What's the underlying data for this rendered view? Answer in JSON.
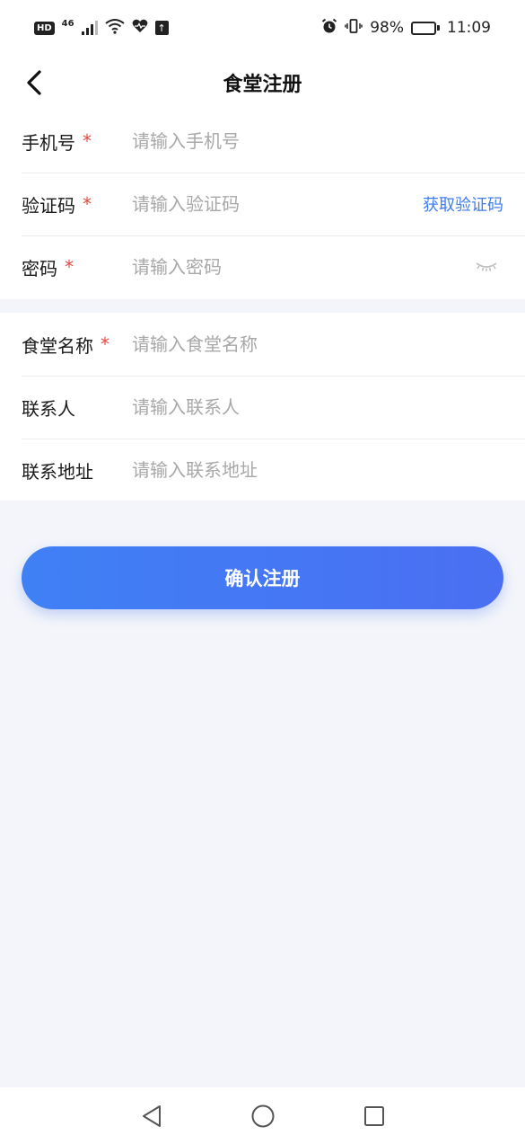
{
  "status_bar": {
    "hd_badge": "HD",
    "network": "46",
    "battery_percent": "98%",
    "battery_level": 0.98,
    "time": "11:09",
    "icons": [
      "hd-icon",
      "signal-icon",
      "wifi-icon",
      "heart-icon",
      "upload-icon",
      "alarm-icon",
      "vibrate-icon",
      "battery-icon"
    ]
  },
  "header": {
    "title": "食堂注册",
    "back_icon": "chevron-left-icon"
  },
  "form": {
    "phone": {
      "label": "手机号",
      "required_mark": "*",
      "placeholder": "请输入手机号",
      "value": ""
    },
    "code": {
      "label": "验证码",
      "required_mark": "*",
      "placeholder": "请输入验证码",
      "value": "",
      "action": "获取验证码"
    },
    "password": {
      "label": "密码",
      "required_mark": "*",
      "placeholder": "请输入密码",
      "value": "",
      "toggle_icon": "eye-closed-icon"
    },
    "canteen_name": {
      "label": "食堂名称",
      "required_mark": "*",
      "placeholder": "请输入食堂名称",
      "value": ""
    },
    "contact": {
      "label": "联系人",
      "placeholder": "请输入联系人",
      "value": ""
    },
    "address": {
      "label": "联系地址",
      "placeholder": "请输入联系地址",
      "value": ""
    }
  },
  "submit": {
    "label": "确认注册"
  },
  "colors": {
    "accent": "#3f7cf0",
    "required": "#e5493f",
    "background": "#f3f5fa",
    "button_start": "#3f80f5",
    "button_end": "#4a6ff2"
  },
  "system_nav": {
    "icons": [
      "back-triangle-icon",
      "home-circle-icon",
      "recents-square-icon"
    ]
  }
}
